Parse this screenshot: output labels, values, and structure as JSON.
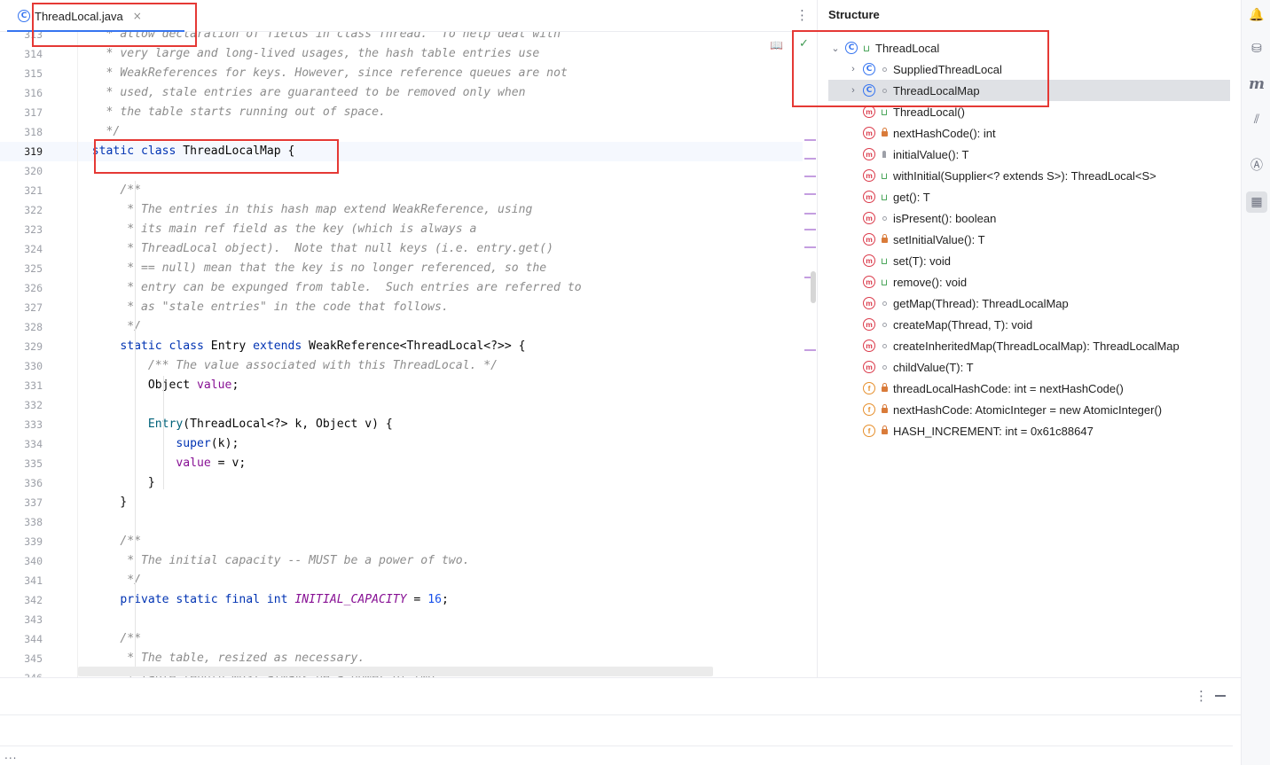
{
  "editor": {
    "tab": {
      "icon": "class-icon",
      "label": "ThreadLocal.java",
      "close": "×"
    },
    "current_line": 319,
    "lines": [
      {
        "n": 313,
        "html": "    <span class=\"cmt\">* allow declaration of fields in class Thread.  To help deal with</span>"
      },
      {
        "n": 314,
        "html": "    <span class=\"cmt\">* very large and long-lived usages, the hash table entries use</span>"
      },
      {
        "n": 315,
        "html": "    <span class=\"cmt\">* WeakReferences for keys. However, since reference queues are not</span>"
      },
      {
        "n": 316,
        "html": "    <span class=\"cmt\">* used, stale entries are guaranteed to be removed only when</span>"
      },
      {
        "n": 317,
        "html": "    <span class=\"cmt\">* the table starts running out of space.</span>"
      },
      {
        "n": 318,
        "html": "    <span class=\"cmt\">*/</span>"
      },
      {
        "n": 319,
        "html": "  <span class=\"kw\">static class</span> ThreadLocalMap {"
      },
      {
        "n": 320,
        "html": ""
      },
      {
        "n": 321,
        "html": "      <span class=\"cmt\">/**</span>"
      },
      {
        "n": 322,
        "html": "       <span class=\"cmt\">* The entries in this hash map extend WeakReference, using</span>"
      },
      {
        "n": 323,
        "html": "       <span class=\"cmt\">* its main ref field as the key (which is always a</span>"
      },
      {
        "n": 324,
        "html": "       <span class=\"cmt\">* ThreadLocal object).  Note that null keys (i.e. entry.get()</span>"
      },
      {
        "n": 325,
        "html": "       <span class=\"cmt\">* == null) mean that the key is no longer referenced, so the</span>"
      },
      {
        "n": 326,
        "html": "       <span class=\"cmt\">* entry can be expunged from table.  Such entries are referred to</span>"
      },
      {
        "n": 327,
        "html": "       <span class=\"cmt\">* as \"stale entries\" in the code that follows.</span>"
      },
      {
        "n": 328,
        "html": "       <span class=\"cmt\">*/</span>"
      },
      {
        "n": 329,
        "html": "      <span class=\"kw\">static class</span> Entry <span class=\"kw\">extends</span> WeakReference&lt;ThreadLocal&lt;?&gt;&gt; {"
      },
      {
        "n": 330,
        "html": "          <span class=\"cmt\">/** The value associated with this ThreadLocal. */</span>"
      },
      {
        "n": 331,
        "html": "          Object <span class=\"fld\">value</span>;"
      },
      {
        "n": 332,
        "html": ""
      },
      {
        "n": 333,
        "html": "          <span style=\"color:#00627a\">Entry</span>(ThreadLocal&lt;?&gt; k, Object v) {"
      },
      {
        "n": 334,
        "html": "              <span class=\"kw\">super</span>(k);"
      },
      {
        "n": 335,
        "html": "              <span class=\"fld\">value</span> = v;"
      },
      {
        "n": 336,
        "html": "          }"
      },
      {
        "n": 337,
        "html": "      }"
      },
      {
        "n": 338,
        "html": ""
      },
      {
        "n": 339,
        "html": "      <span class=\"cmt\">/**</span>"
      },
      {
        "n": 340,
        "html": "       <span class=\"cmt\">* The initial capacity -- MUST be a power of two.</span>"
      },
      {
        "n": 341,
        "html": "       <span class=\"cmt\">*/</span>"
      },
      {
        "n": 342,
        "html": "      <span class=\"kw\">private static final int</span> <span class=\"cst\">INITIAL_CAPACITY</span> = <span class=\"num\">16</span>;"
      },
      {
        "n": 343,
        "html": ""
      },
      {
        "n": 344,
        "html": "      <span class=\"cmt\">/**</span>"
      },
      {
        "n": 345,
        "html": "       <span class=\"cmt\">* The table, resized as necessary.</span>"
      },
      {
        "n": 346,
        "html": "       <span class=\"cmt\">* table.length MUST always be a power of two.</span>"
      }
    ]
  },
  "structure": {
    "title": "Structure",
    "items": [
      {
        "depth": 0,
        "chevron": "expanded",
        "badge": "C",
        "vis": "pub",
        "label": "ThreadLocal",
        "selected": false
      },
      {
        "depth": 1,
        "chevron": "collapsed",
        "badge": "C",
        "vis": "pkg",
        "label": "SuppliedThreadLocal",
        "selected": false
      },
      {
        "depth": 1,
        "chevron": "collapsed",
        "badge": "C",
        "vis": "pkg",
        "label": "ThreadLocalMap",
        "selected": true
      },
      {
        "depth": 1,
        "chevron": "",
        "badge": "m",
        "vis": "pub",
        "label": "ThreadLocal()",
        "selected": false
      },
      {
        "depth": 1,
        "chevron": "",
        "badge": "m",
        "vis": "priv",
        "label": "nextHashCode(): int",
        "selected": false
      },
      {
        "depth": 1,
        "chevron": "",
        "badge": "m",
        "vis": "prot",
        "label": "initialValue(): T",
        "selected": false
      },
      {
        "depth": 1,
        "chevron": "",
        "badge": "m",
        "vis": "pub",
        "label": "withInitial(Supplier<? extends S>): ThreadLocal<S>",
        "selected": false
      },
      {
        "depth": 1,
        "chevron": "",
        "badge": "m",
        "vis": "pub",
        "label": "get(): T",
        "selected": false
      },
      {
        "depth": 1,
        "chevron": "",
        "badge": "m",
        "vis": "pkg",
        "label": "isPresent(): boolean",
        "selected": false
      },
      {
        "depth": 1,
        "chevron": "",
        "badge": "m",
        "vis": "priv",
        "label": "setInitialValue(): T",
        "selected": false
      },
      {
        "depth": 1,
        "chevron": "",
        "badge": "m",
        "vis": "pub",
        "label": "set(T): void",
        "selected": false
      },
      {
        "depth": 1,
        "chevron": "",
        "badge": "m",
        "vis": "pub",
        "label": "remove(): void",
        "selected": false
      },
      {
        "depth": 1,
        "chevron": "",
        "badge": "m",
        "vis": "pkg",
        "label": "getMap(Thread): ThreadLocalMap",
        "selected": false
      },
      {
        "depth": 1,
        "chevron": "",
        "badge": "m",
        "vis": "pkg",
        "label": "createMap(Thread, T): void",
        "selected": false
      },
      {
        "depth": 1,
        "chevron": "",
        "badge": "m",
        "vis": "pkg",
        "label": "createInheritedMap(ThreadLocalMap): ThreadLocalMap",
        "selected": false
      },
      {
        "depth": 1,
        "chevron": "",
        "badge": "m",
        "vis": "pkg",
        "label": "childValue(T): T",
        "selected": false
      },
      {
        "depth": 1,
        "chevron": "",
        "badge": "f",
        "vis": "priv",
        "label": "threadLocalHashCode: int = nextHashCode()",
        "selected": false
      },
      {
        "depth": 1,
        "chevron": "",
        "badge": "f",
        "vis": "priv",
        "label": "nextHashCode: AtomicInteger = new AtomicInteger()",
        "selected": false
      },
      {
        "depth": 1,
        "chevron": "",
        "badge": "f",
        "vis": "priv",
        "label": "HASH_INCREMENT: int = 0x61c88647",
        "selected": false
      }
    ]
  },
  "tool_strip": {
    "icons": [
      "notifications-icon",
      "database-icon",
      "maven-icon",
      "profiler-icon",
      "ai-assistant-icon",
      "structure-icon"
    ],
    "glyphs": [
      "🔔",
      "⛁",
      "m",
      "⫽",
      "Ⓐ",
      "▦"
    ],
    "active": "structure-icon"
  },
  "bottom": {
    "ellipsis": "..."
  },
  "colors": {
    "accent": "#3574f0",
    "annotation_red": "#e53935",
    "keyword": "#0033b3",
    "comment": "#8c8c8c",
    "field": "#871094",
    "method_badge": "#db3b4b",
    "field_badge": "#e68f2c"
  }
}
